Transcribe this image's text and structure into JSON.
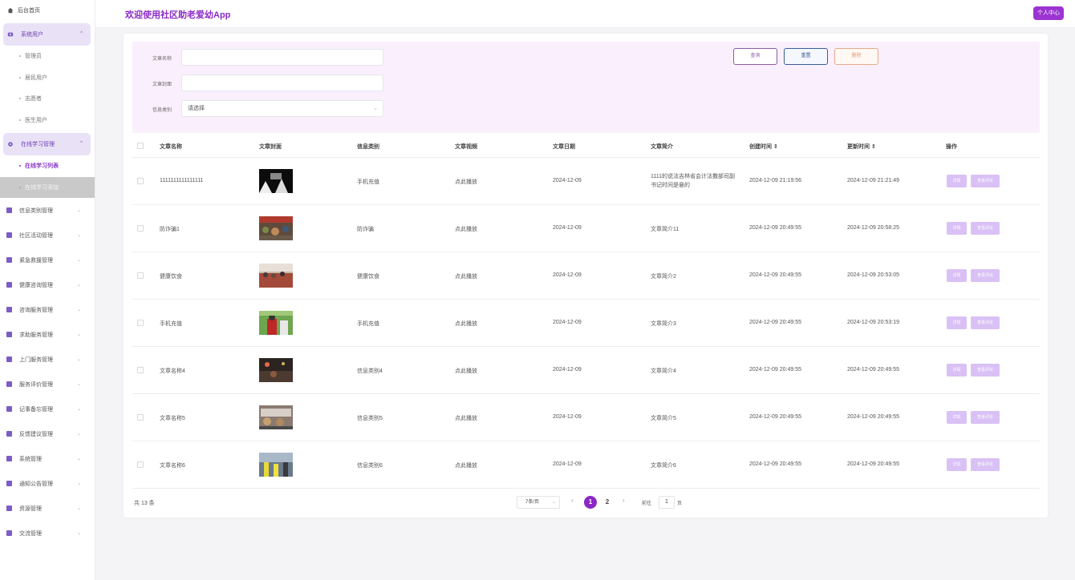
{
  "app": {
    "title": "欢迎使用社区助老爱幼App",
    "personal_center": "个人中心"
  },
  "sidebar": {
    "home": "后台首页",
    "groups": [
      {
        "label": "系统用户",
        "sub": [
          "管理员",
          "居民用户",
          "志愿者",
          "医生用户"
        ]
      },
      {
        "label": "在线学习管理",
        "sub": [
          "在线学习列表",
          "在线学习添加"
        ]
      }
    ],
    "items": [
      "信息类别管理",
      "社区活动管理",
      "紧急救援管理",
      "健康咨询管理",
      "咨询服务管理",
      "求助服务管理",
      "上门服务管理",
      "服务评价管理",
      "记事备忘管理",
      "反馈建议管理",
      "系统管理",
      "通知公告管理",
      "资源管理",
      "交流管理"
    ]
  },
  "search": {
    "label_name": "文章名称",
    "label_cover": "文章封面",
    "label_category": "信息类别",
    "category_placeholder": "请选择",
    "btn_query": "查询",
    "btn_reset": "重置",
    "btn_delete": "删除"
  },
  "table": {
    "headers": [
      "文章名称",
      "文章封面",
      "信息类别",
      "文章视频",
      "文章日期",
      "文章简介",
      "创建时间 ⇕",
      "更新时间 ⇕",
      "操作"
    ],
    "actions": {
      "detail": "详情",
      "comments": "查看评论"
    },
    "rows": [
      {
        "name": "1111111111111111",
        "category": "手机充值",
        "video": "点此播放",
        "date": "2024-12-09",
        "intro": "1111的说法吉林省会计法撒部司副书记时间是悬的",
        "created": "2024-12-09 21:19:56",
        "updated": "2024-12-09 21:21:49",
        "thumb": "dark"
      },
      {
        "name": "防诈骗1",
        "category": "防诈骗",
        "video": "点此播放",
        "date": "2024-12-09",
        "intro": "文章简介11",
        "created": "2024-12-09 20:49:55",
        "updated": "2024-12-09 20:58:25",
        "thumb": "market"
      },
      {
        "name": "健康饮食",
        "category": "健康饮食",
        "video": "点此播放",
        "date": "2024-12-09",
        "intro": "文章简介2",
        "created": "2024-12-09 20:49:55",
        "updated": "2024-12-09 20:53:05",
        "thumb": "crowd"
      },
      {
        "name": "手机充值",
        "category": "手机充值",
        "video": "点此播放",
        "date": "2024-12-09",
        "intro": "文章简介3",
        "created": "2024-12-09 20:49:55",
        "updated": "2024-12-09 20:53:19",
        "thumb": "outdoor"
      },
      {
        "name": "文章名称4",
        "category": "信息类别4",
        "video": "点此播放",
        "date": "2024-12-09",
        "intro": "文章简介4",
        "created": "2024-12-09 20:49:55",
        "updated": "2024-12-09 20:49:55",
        "thumb": "night"
      },
      {
        "name": "文章名称5",
        "category": "信息类别5",
        "video": "点此播放",
        "date": "2024-12-09",
        "intro": "文章简介5",
        "created": "2024-12-09 20:49:55",
        "updated": "2024-12-09 20:49:55",
        "thumb": "food"
      },
      {
        "name": "文章名称6",
        "category": "信息类别6",
        "video": "点此播放",
        "date": "2024-12-09",
        "intro": "文章简介6",
        "created": "2024-12-09 20:49:55",
        "updated": "2024-12-09 20:49:55",
        "thumb": "street"
      }
    ]
  },
  "pagination": {
    "total": "共 13 条",
    "page_size": "7条/页",
    "pages": [
      "1",
      "2"
    ],
    "current": "1",
    "goto_prefix": "前往",
    "goto_value": "1",
    "goto_suffix": "页"
  },
  "colors": {
    "accent": "#8a27c6",
    "panel": "#faf0fd",
    "action": "#d9c1f5"
  }
}
